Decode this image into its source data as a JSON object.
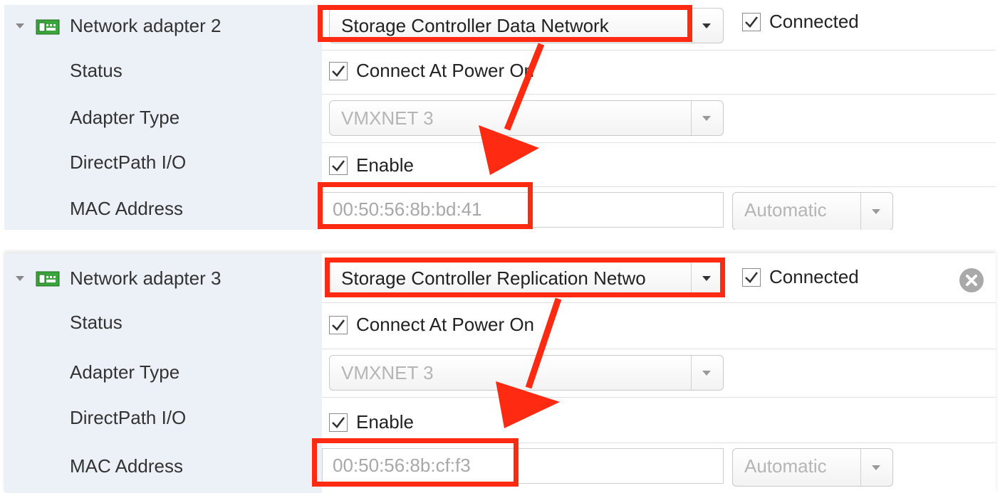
{
  "adapters": [
    {
      "title": "Network adapter 2",
      "network": "Storage Controller Data Network",
      "connected_label": "Connected",
      "status_label": "Status",
      "connect_power_label": "Connect At Power On",
      "adapter_type_label": "Adapter Type",
      "adapter_type": "VMXNET 3",
      "directpath_label": "DirectPath I/O",
      "enable_label": "Enable",
      "mac_label": "MAC Address",
      "mac": "00:50:56:8b:bd:41",
      "mac_mode": "Automatic"
    },
    {
      "title": "Network adapter 3",
      "network": "Storage Controller Replication Netwo",
      "connected_label": "Connected",
      "status_label": "Status",
      "connect_power_label": "Connect At Power On",
      "adapter_type_label": "Adapter Type",
      "adapter_type": "VMXNET 3",
      "directpath_label": "DirectPath I/O",
      "enable_label": "Enable",
      "mac_label": "MAC Address",
      "mac": "00:50:56:8b:cf:f3",
      "mac_mode": "Automatic"
    }
  ],
  "icons": {
    "expander": "triangle-down-icon",
    "nic": "network-card-icon",
    "dropdown": "chevron-down-icon",
    "checkbox": "checkmark-icon",
    "remove": "close-circle-icon"
  },
  "colors": {
    "label_column_bg": "#ecf1f7",
    "highlight": "#ff2a12",
    "disabled_text": "#b5b5b5",
    "nic_icon_green": "#3aa53a"
  }
}
